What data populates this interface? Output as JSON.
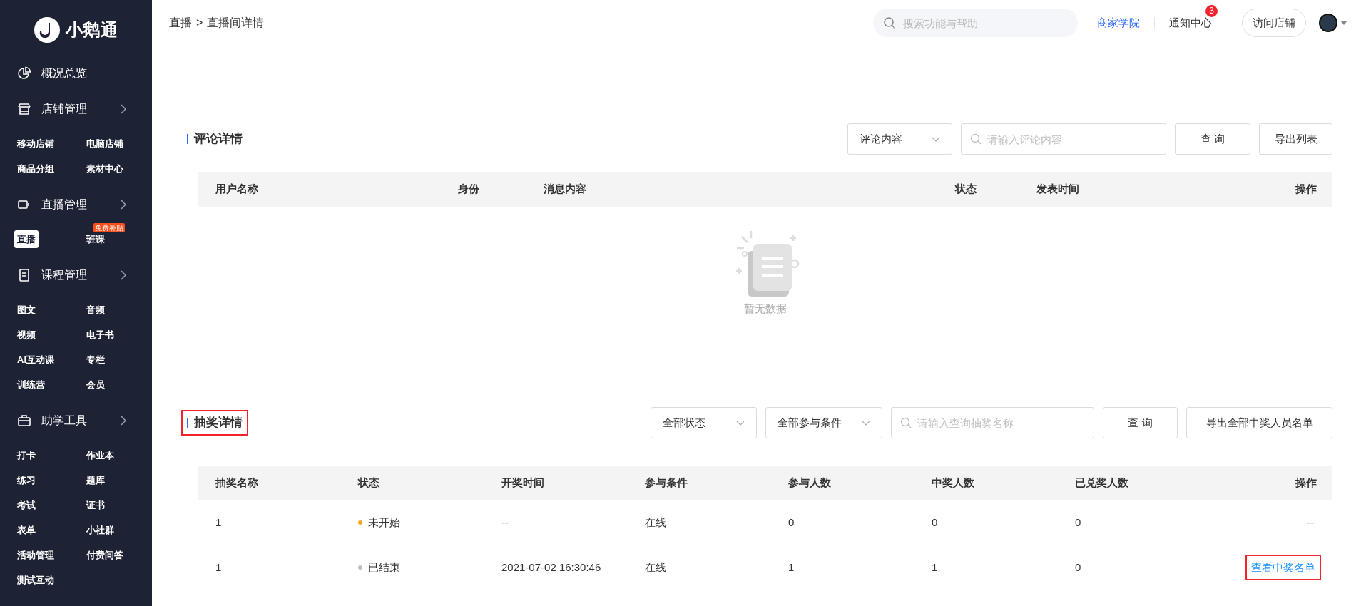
{
  "sidebar": {
    "logo_text": "小鹅通",
    "groups": [
      {
        "label": "概况总览",
        "has_arrow": false
      },
      {
        "label": "店铺管理",
        "has_arrow": true,
        "items": [
          {
            "label": "移动店铺",
            "selected": false
          },
          {
            "label": "电脑店铺",
            "selected": false
          },
          {
            "label": "商品分组",
            "selected": false
          },
          {
            "label": "素材中心",
            "selected": false
          }
        ]
      },
      {
        "label": "直播管理",
        "has_arrow": true,
        "items": [
          {
            "label": "直播",
            "selected": true
          },
          {
            "label": "班课",
            "selected": false,
            "badge": "免费补贴"
          }
        ]
      },
      {
        "label": "课程管理",
        "has_arrow": true,
        "items": [
          {
            "label": "图文",
            "selected": false
          },
          {
            "label": "音频",
            "selected": false
          },
          {
            "label": "视频",
            "selected": false
          },
          {
            "label": "电子书",
            "selected": false
          },
          {
            "label": "AI互动课",
            "selected": false
          },
          {
            "label": "专栏",
            "selected": false
          },
          {
            "label": "训练营",
            "selected": false
          },
          {
            "label": "会员",
            "selected": false
          }
        ]
      },
      {
        "label": "助学工具",
        "has_arrow": true,
        "items": [
          {
            "label": "打卡",
            "selected": false
          },
          {
            "label": "作业本",
            "selected": false
          },
          {
            "label": "练习",
            "selected": false
          },
          {
            "label": "题库",
            "selected": false
          },
          {
            "label": "考试",
            "selected": false
          },
          {
            "label": "证书",
            "selected": false
          },
          {
            "label": "表单",
            "selected": false
          },
          {
            "label": "小社群",
            "selected": false
          },
          {
            "label": "活动管理",
            "selected": false
          },
          {
            "label": "付费问答",
            "selected": false
          },
          {
            "label": "测试互动",
            "selected": false
          }
        ]
      }
    ]
  },
  "header": {
    "breadcrumb": [
      "直播",
      "直播间详情"
    ],
    "breadcrumb_separator": ">",
    "search": {
      "placeholder": "搜索功能与帮助"
    },
    "academy_link": "商家学院",
    "notifications": {
      "label": "通知中心",
      "count": "3"
    },
    "visit_store_button": "访问店铺"
  },
  "comments": {
    "title": "评论详情",
    "highlighted": false,
    "filter_select": "评论内容",
    "search": {
      "placeholder": "请输入评论内容"
    },
    "query_button": "查 询",
    "export_button": "导出列表",
    "columns": [
      "用户名称",
      "身份",
      "消息内容",
      "状态",
      "发表时间",
      "操作"
    ],
    "empty_text": "暂无数据"
  },
  "lottery": {
    "title": "抽奖详情",
    "highlighted": true,
    "filters": [
      "全部状态",
      "全部参与条件"
    ],
    "search": {
      "placeholder": "请输入查询抽奖名称"
    },
    "query_button": "查 询",
    "export_button": "导出全部中奖人员名单",
    "columns": [
      "抽奖名称",
      "状态",
      "开奖时间",
      "参与条件",
      "参与人数",
      "中奖人数",
      "已兑奖人数",
      "操作"
    ],
    "rows": [
      {
        "name": "1",
        "status": "未开始",
        "color": "#f5a623",
        "draw_time": "--",
        "condition": "在线",
        "participants": "0",
        "winners": "0",
        "redeemed": "0",
        "action": {
          "kind": "text",
          "label": "--",
          "highlighted": false
        }
      },
      {
        "name": "1",
        "status": "已结束",
        "color": "#bfbfbf",
        "draw_time": "2021-07-02 16:30:46",
        "condition": "在线",
        "participants": "1",
        "winners": "1",
        "redeemed": "0",
        "action": {
          "kind": "link",
          "label": "查看中奖名单",
          "highlighted": true
        }
      }
    ]
  }
}
